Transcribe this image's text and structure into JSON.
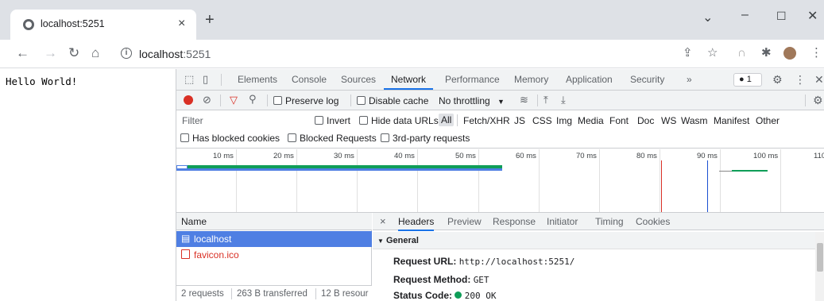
{
  "browser": {
    "tab_title": "localhost:5251",
    "close_tab": "×",
    "new_tab": "+",
    "url_host": "localhost",
    "url_port": ":5251"
  },
  "page": {
    "text": "Hello World!"
  },
  "devtools": {
    "tabs": [
      "Elements",
      "Console",
      "Sources",
      "Network",
      "Performance",
      "Memory",
      "Application",
      "Security"
    ],
    "more_tabs": "»",
    "issue_count": "1",
    "network_toolbar": {
      "preserve_log": "Preserve log",
      "disable_cache": "Disable cache",
      "throttling": "No throttling"
    },
    "filter": {
      "placeholder": "Filter",
      "invert": "Invert",
      "hide_data_urls": "Hide data URLs",
      "types": [
        "All",
        "Fetch/XHR",
        "JS",
        "CSS",
        "Img",
        "Media",
        "Font",
        "Doc",
        "WS",
        "Wasm",
        "Manifest",
        "Other"
      ],
      "has_blocked_cookies": "Has blocked cookies",
      "blocked_requests": "Blocked Requests",
      "third_party": "3rd-party requests"
    },
    "timeline": {
      "ticks": [
        "10 ms",
        "20 ms",
        "30 ms",
        "40 ms",
        "50 ms",
        "60 ms",
        "70 ms",
        "80 ms",
        "90 ms",
        "100 ms",
        "110"
      ]
    },
    "requests": {
      "header": "Name",
      "rows": [
        {
          "name": "localhost",
          "selected": true
        },
        {
          "name": "favicon.ico",
          "selected": false
        }
      ],
      "summary": {
        "requests": "2 requests",
        "transferred": "263 B transferred",
        "resources": "12 B resour"
      }
    },
    "details": {
      "close": "×",
      "tabs": [
        "Headers",
        "Preview",
        "Response",
        "Initiator",
        "Timing",
        "Cookies"
      ],
      "section": "General",
      "fields": [
        {
          "key": "Request URL:",
          "value": "http://localhost:5251/"
        },
        {
          "key": "Request Method:",
          "value": "GET"
        },
        {
          "key": "Status Code:",
          "value": "200 OK"
        }
      ]
    },
    "colors": {
      "accent": "#1a73e8",
      "selected_row": "#4f7fe3",
      "error_red": "#d93025",
      "status_green": "#0f9d58"
    }
  }
}
